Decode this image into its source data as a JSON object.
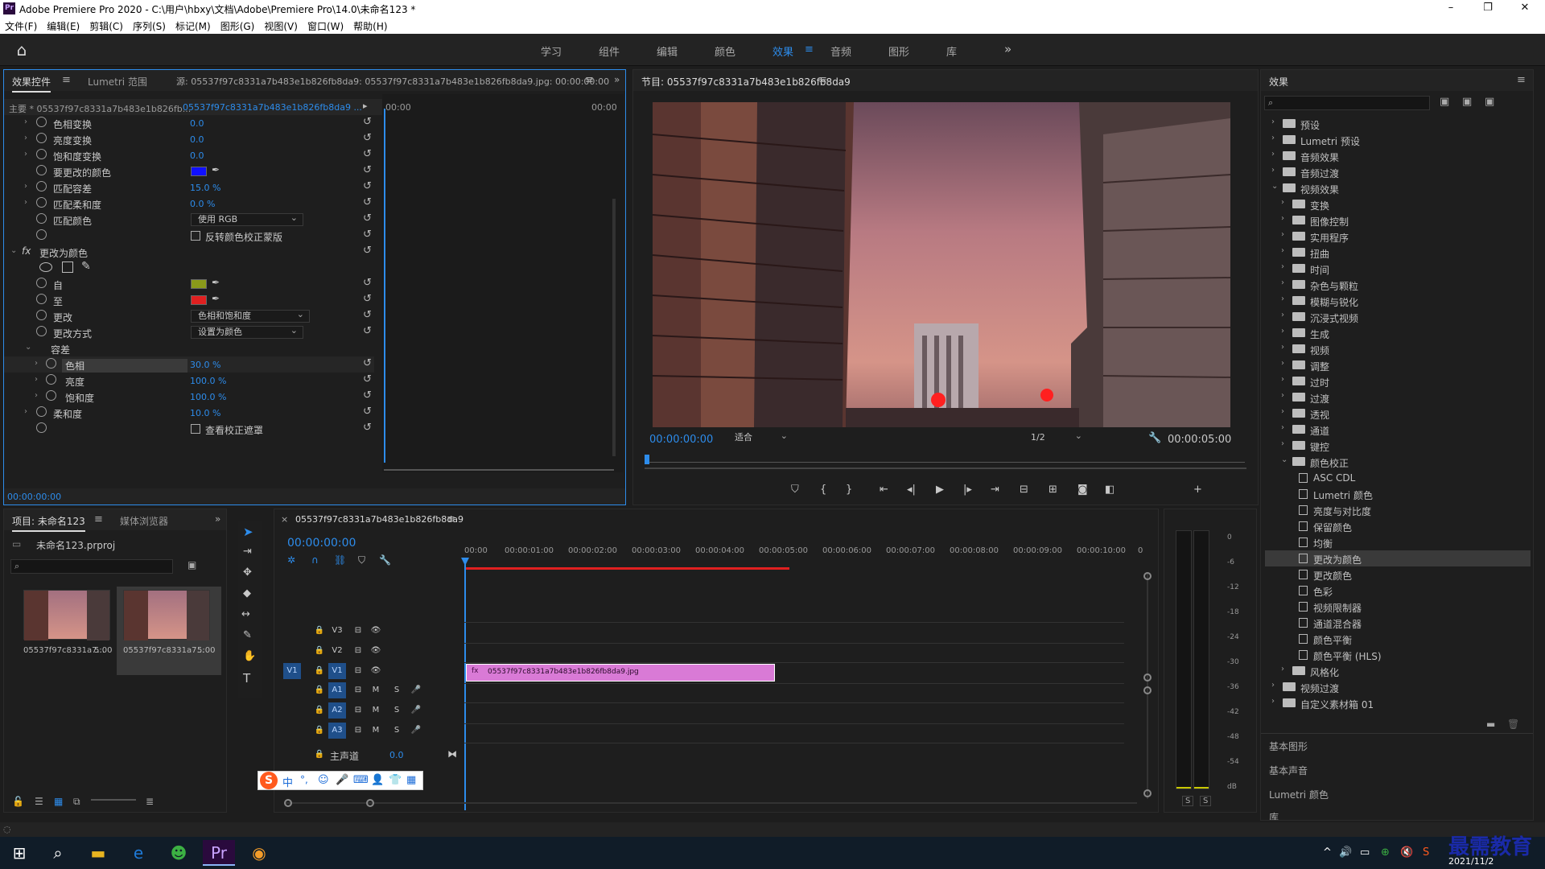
{
  "window": {
    "title": "Adobe Premiere Pro 2020 - C:\\用户\\hbxy\\文档\\Adobe\\Premiere Pro\\14.0\\未命名123 *",
    "logo": "Pr",
    "controls": [
      "–",
      "❐",
      "✕"
    ]
  },
  "menu": [
    "文件(F)",
    "编辑(E)",
    "剪辑(C)",
    "序列(S)",
    "标记(M)",
    "图形(G)",
    "视图(V)",
    "窗口(W)",
    "帮助(H)"
  ],
  "workspaces": {
    "items": [
      "学习",
      "组件",
      "编辑",
      "颜色",
      "效果",
      "音频",
      "图形",
      "库"
    ],
    "active": "效果",
    "more": "»"
  },
  "effect_controls": {
    "tabs": [
      "效果控件",
      "Lumetri 范围"
    ],
    "source": "源: 05537f97c8331a7b483e1b826fb8da9: 05537f97c8331a7b483e1b826fb8da9.jpg: 00:00:00:00",
    "master": "主要 * 05537f97c8331a7b483e1b826fb...",
    "clip": "05537f97c8331a7b483e1b826fb8da9 ...",
    "tc_start": "00:00",
    "tc_end": "00:00",
    "rows": [
      {
        "name": "色相变换",
        "value": "0.0"
      },
      {
        "name": "亮度变换",
        "value": "0.0"
      },
      {
        "name": "饱和度变换",
        "value": "0.0"
      },
      {
        "name": "要更改的颜色",
        "color": "#1010ff"
      },
      {
        "name": "匹配容差",
        "value": "15.0 %"
      },
      {
        "name": "匹配柔和度",
        "value": "0.0 %"
      },
      {
        "name": "匹配颜色",
        "dropdown": "使用 RGB"
      },
      {
        "checkbox": "反转颜色校正蒙版"
      }
    ],
    "fx_name": "更改为颜色",
    "rows2": [
      {
        "name": "自",
        "color": "#8a9a1a"
      },
      {
        "name": "至",
        "color": "#e02020"
      },
      {
        "name": "更改",
        "dropdown": "色相和饱和度"
      },
      {
        "name": "更改方式",
        "dropdown": "设置为颜色"
      },
      {
        "name": "容差"
      },
      {
        "name": "色相",
        "value": "30.0 %"
      },
      {
        "name": "亮度",
        "value": "100.0 %"
      },
      {
        "name": "饱和度",
        "value": "100.0 %"
      },
      {
        "name": "柔和度",
        "value": "10.0 %"
      },
      {
        "checkbox": "查看校正遮罩"
      }
    ],
    "footer_tc": "00:00:00:00"
  },
  "program": {
    "title": "节目: 05537f97c8331a7b483e1b826fb8da9",
    "tc": "00:00:00:00",
    "fit": "适合",
    "res": "1/2",
    "duration": "00:00:05:00"
  },
  "effects_panel": {
    "title": "效果",
    "tree": [
      {
        "label": "预设",
        "level": 0,
        "type": "folder",
        "open": false
      },
      {
        "label": "Lumetri 预设",
        "level": 0,
        "type": "folder",
        "open": false
      },
      {
        "label": "音频效果",
        "level": 0,
        "type": "folder",
        "open": false
      },
      {
        "label": "音频过渡",
        "level": 0,
        "type": "folder",
        "open": false
      },
      {
        "label": "视频效果",
        "level": 0,
        "type": "folder",
        "open": true
      },
      {
        "label": "变换",
        "level": 1,
        "type": "folder",
        "open": false
      },
      {
        "label": "图像控制",
        "level": 1,
        "type": "folder",
        "open": false
      },
      {
        "label": "实用程序",
        "level": 1,
        "type": "folder",
        "open": false
      },
      {
        "label": "扭曲",
        "level": 1,
        "type": "folder",
        "open": false
      },
      {
        "label": "时间",
        "level": 1,
        "type": "folder",
        "open": false
      },
      {
        "label": "杂色与颗粒",
        "level": 1,
        "type": "folder",
        "open": false
      },
      {
        "label": "模糊与锐化",
        "level": 1,
        "type": "folder",
        "open": false
      },
      {
        "label": "沉浸式视频",
        "level": 1,
        "type": "folder",
        "open": false
      },
      {
        "label": "生成",
        "level": 1,
        "type": "folder",
        "open": false
      },
      {
        "label": "视频",
        "level": 1,
        "type": "folder",
        "open": false
      },
      {
        "label": "调整",
        "level": 1,
        "type": "folder",
        "open": false
      },
      {
        "label": "过时",
        "level": 1,
        "type": "folder",
        "open": false
      },
      {
        "label": "过渡",
        "level": 1,
        "type": "folder",
        "open": false
      },
      {
        "label": "透视",
        "level": 1,
        "type": "folder",
        "open": false
      },
      {
        "label": "通道",
        "level": 1,
        "type": "folder",
        "open": false
      },
      {
        "label": "键控",
        "level": 1,
        "type": "folder",
        "open": false
      },
      {
        "label": "颜色校正",
        "level": 1,
        "type": "folder",
        "open": true
      },
      {
        "label": "ASC CDL",
        "level": 2,
        "type": "file"
      },
      {
        "label": "Lumetri 颜色",
        "level": 2,
        "type": "file"
      },
      {
        "label": "亮度与对比度",
        "level": 2,
        "type": "file"
      },
      {
        "label": "保留颜色",
        "level": 2,
        "type": "file"
      },
      {
        "label": "均衡",
        "level": 2,
        "type": "file"
      },
      {
        "label": "更改为颜色",
        "level": 2,
        "type": "file",
        "selected": true
      },
      {
        "label": "更改颜色",
        "level": 2,
        "type": "file"
      },
      {
        "label": "色彩",
        "level": 2,
        "type": "file"
      },
      {
        "label": "视频限制器",
        "level": 2,
        "type": "file"
      },
      {
        "label": "通道混合器",
        "level": 2,
        "type": "file"
      },
      {
        "label": "颜色平衡",
        "level": 2,
        "type": "file"
      },
      {
        "label": "颜色平衡 (HLS)",
        "level": 2,
        "type": "file"
      },
      {
        "label": "风格化",
        "level": 1,
        "type": "folder",
        "open": false
      },
      {
        "label": "视频过渡",
        "level": 0,
        "type": "folder",
        "open": false
      },
      {
        "label": "自定义素材箱 01",
        "level": 0,
        "type": "folder",
        "open": false
      }
    ],
    "sections": [
      "基本图形",
      "基本声音",
      "Lumetri 颜色",
      "库"
    ]
  },
  "project": {
    "tabs": [
      "项目: 未命名123",
      "媒体浏览器"
    ],
    "file": "未命名123.prproj",
    "items": [
      {
        "name": "05537f97c8331a7...",
        "dur": "5:00"
      },
      {
        "name": "05537f97c8331a7...",
        "dur": "5:00"
      }
    ]
  },
  "timeline": {
    "tab": "05537f97c8331a7b483e1b826fb8da9",
    "tc": "00:00:00:00",
    "ruler": [
      "00:00",
      "00:00:01:00",
      "00:00:02:00",
      "00:00:03:00",
      "00:00:04:00",
      "00:00:05:00",
      "00:00:06:00",
      "00:00:07:00",
      "00:00:08:00",
      "00:00:09:00",
      "00:00:10:00",
      "0"
    ],
    "video_tracks": [
      "V3",
      "V2",
      "V1"
    ],
    "audio_tracks": [
      "A1",
      "A2",
      "A3"
    ],
    "source_patch": "V1",
    "master_label": "主声道",
    "master_val": "0.0",
    "clip": "05537f97c8331a7b483e1b826fb8da9.jpg",
    "m_label": "M",
    "s_label": "S"
  },
  "meter": {
    "labels": [
      "0",
      "-6",
      "-12",
      "-18",
      "-24",
      "-30",
      "-36",
      "-42",
      "-48",
      "-54",
      "dB"
    ],
    "solo": [
      "S",
      "S"
    ]
  },
  "ime": {
    "items": [
      "S",
      "中",
      "°,",
      "☺",
      "🎤",
      "⌨",
      "👤",
      "👕",
      "▦"
    ]
  },
  "taskbar": {
    "time": "2021/11/2",
    "watermark": "最需教育",
    "tray": [
      "^",
      "🔊",
      "▭",
      "⊕",
      "🔇",
      "S"
    ]
  }
}
